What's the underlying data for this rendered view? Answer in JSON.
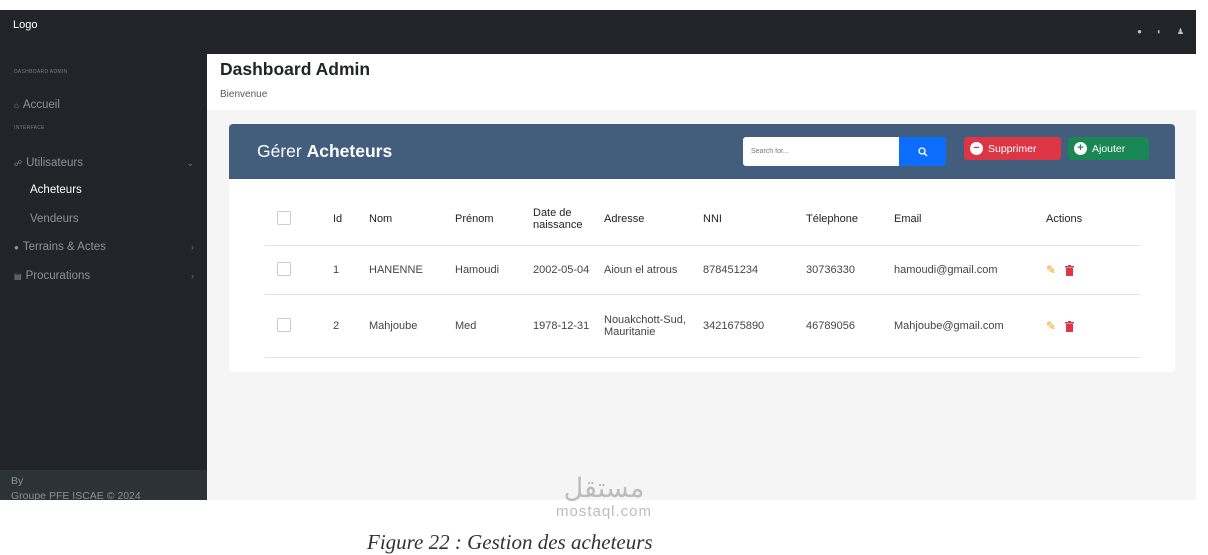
{
  "topbar": {
    "logo": "Logo",
    "icons": [
      "globe-icon",
      "contrast-icon",
      "user-icon"
    ]
  },
  "sidebar": {
    "heading_dashboard": "DASHBOARD ADMIN",
    "accueil": "Accueil",
    "heading_interface": "INTERFACE",
    "utilisateurs": "Utilisateurs",
    "acheteurs": "Acheteurs",
    "vendeurs": "Vendeurs",
    "terrains": "Terrains & Actes",
    "procurations": "Procurations",
    "footer_by": "By",
    "footer_group": "Groupe PFE ISCAE © 2024"
  },
  "header": {
    "title": "Dashboard Admin",
    "subtitle": "Bienvenue"
  },
  "card": {
    "title_prefix": "Gérer",
    "title_bold": "Acheteurs",
    "search_placeholder": "Search for...",
    "delete_label": "Supprimer",
    "add_label": "Ajouter"
  },
  "table": {
    "headers": [
      "Id",
      "Nom",
      "Prénom",
      "Date de naissance",
      "Adresse",
      "NNI",
      "Télephone",
      "Email",
      "Actions"
    ],
    "rows": [
      {
        "id": "1",
        "nom": "HANENNE",
        "prenom": "Hamoudi",
        "date": "2002-05-04",
        "adresse": "Aioun el atrous",
        "nni": "878451234",
        "telephone": "30736330",
        "email": "hamoudi@gmail.com"
      },
      {
        "id": "2",
        "nom": "Mahjoube",
        "prenom": "Med",
        "date": "1978-12-31",
        "adresse": "Nouakchott-Sud, Mauritanie",
        "nni": "3421675890",
        "telephone": "46789056",
        "email": "Mahjoube@gmail.com"
      }
    ]
  },
  "colors": {
    "header_blue": "#435d7d",
    "danger": "#dc3545",
    "success": "#198754",
    "primary": "#0d6efd",
    "sidebar": "#212529",
    "edit": "#f59c1a"
  },
  "watermark": {
    "arabic": "مستقل",
    "latin": "mostaql.com"
  },
  "caption": "Figure 22 : Gestion des acheteurs"
}
